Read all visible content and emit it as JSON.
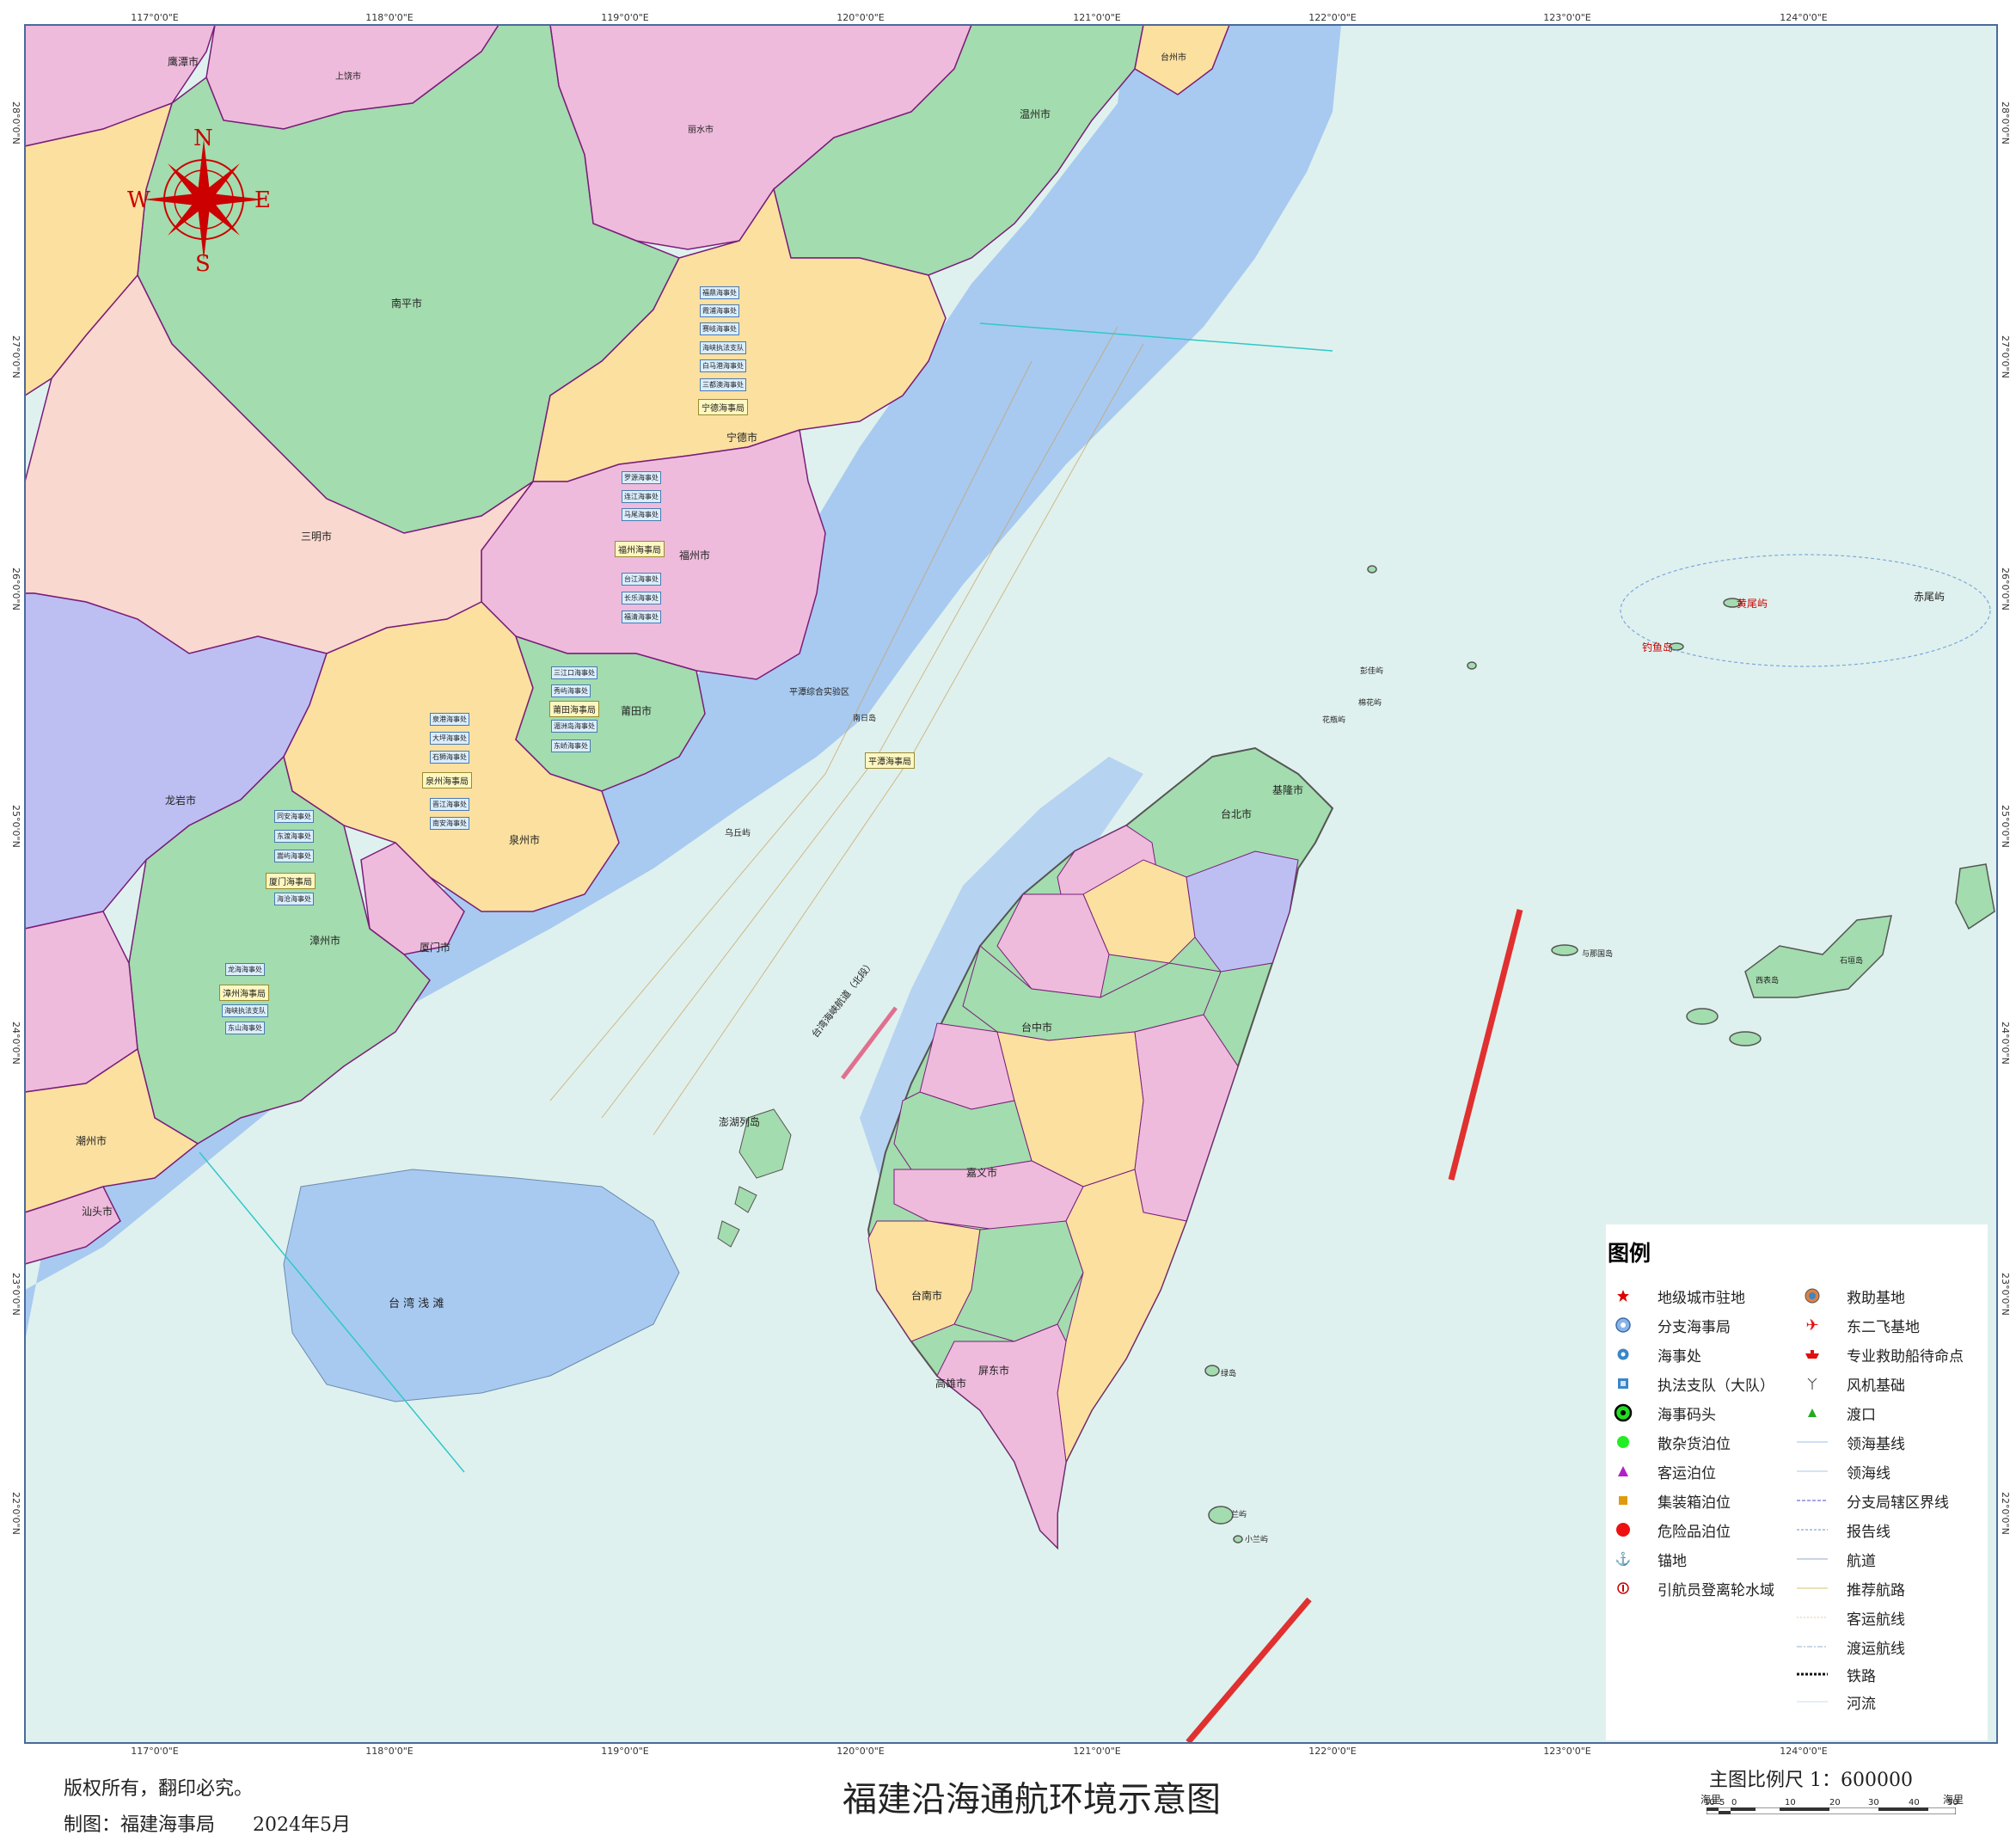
{
  "title": "福建沿海通航环境示意图",
  "copyright": "版权所有，翻印必究。",
  "producer": "制图：福建海事局　　2024年5月",
  "scale": {
    "label": "主图比例尺 1：600000",
    "unit_left": "海里",
    "unit_right": "海里",
    "ticks": [
      "10",
      "5",
      "0",
      "10",
      "20",
      "30",
      "40",
      "50"
    ]
  },
  "compass": {
    "N": "N",
    "S": "S",
    "E": "E",
    "W": "W"
  },
  "graticule": {
    "lon": [
      "117°0'0\"E",
      "118°0'0\"E",
      "119°0'0\"E",
      "120°0'0\"E",
      "121°0'0\"E",
      "122°0'0\"E",
      "123°0'0\"E",
      "124°0'0\"E"
    ],
    "lat": [
      "28°0'0\"N",
      "27°0'0\"N",
      "26°0'0\"N",
      "25°0'0\"N",
      "24°0'0\"N",
      "23°0'0\"N",
      "22°0'0\"N"
    ]
  },
  "cities": {
    "yingtan": "鹰潭市",
    "nanping": "南平市",
    "sanming": "三明市",
    "longyan": "龙岩市",
    "zhangzhou": "漳州市",
    "chaozhou": "潮州市",
    "shantou": "汕头市",
    "quanzhou": "泉州市",
    "xiamen": "厦门市",
    "putian": "莆田市",
    "fuzhou": "福州市",
    "ningde": "宁德市",
    "wenzhou": "温州市",
    "taizhou": "台州市",
    "lishui": "丽水市",
    "shangrao": "上饶市",
    "keelung": "基隆市",
    "taipei": "台北市",
    "taichung": "台中市",
    "chiayi": "嘉义市",
    "tainan": "台南市",
    "kaohsiung": "高雄市",
    "pingtung": "屏东市"
  },
  "msa_bureaus": {
    "ningde": "宁德海事局",
    "fuzhou": "福州海事局",
    "putian": "莆田海事局",
    "quanzhou": "泉州海事局",
    "xiamen": "厦门海事局",
    "zhangzhou": "漳州海事局",
    "pingtan": "平潭海事局"
  },
  "msa_offices": {
    "north": [
      "福鼎海事处",
      "霞浦海事处",
      "赛岐海事处",
      "海峡执法支队",
      "白马港海事处",
      "三都澳海事处"
    ],
    "fuzhou": [
      "罗源海事处",
      "连江海事处",
      "马尾海事处",
      "台江海事处",
      "长乐海事处",
      "福清海事处"
    ],
    "putian": [
      "三江口海事处",
      "秀屿海事处",
      "湄洲岛海事处",
      "东峤海事处"
    ],
    "quanzhou": [
      "泉港海事处",
      "大坪海事处",
      "石狮海事处",
      "晋江海事处",
      "南安海事处"
    ],
    "xiamen": [
      "同安海事处",
      "东渡海事处",
      "嵩屿海事处",
      "海沧海事处"
    ],
    "zhangzhou": [
      "龙海海事处",
      "海峡执法支队",
      "东山海事处"
    ]
  },
  "islands": {
    "wuqiu": "乌丘屿",
    "penghu": "澎湖列岛",
    "taiwan_shoal": "台 湾 浅 滩",
    "huangwei": "黄尾屿",
    "chiwei": "赤尾屿",
    "diaoyu": "钓鱼岛",
    "pengjia": "彭佳屿",
    "mianhua": "棉花屿",
    "huaping": "花瓶屿",
    "lvdao": "绿岛",
    "lanyu": "兰屿",
    "xiaolanyu": "小兰屿",
    "yonaguni": "与那国岛",
    "iriomote": "西表岛",
    "ishigaki": "石垣岛",
    "nanri": "南日岛",
    "haitan": "平潭综合实验区"
  },
  "channel_label": "台湾海峡航道（北段）",
  "legend": {
    "title": "图例",
    "left": [
      {
        "label": "地级城市驻地",
        "icon": "city-star-icon"
      },
      {
        "label": "分支海事局",
        "icon": "branch-msa-icon"
      },
      {
        "label": "海事处",
        "icon": "msa-office-icon"
      },
      {
        "label": "执法支队（大队）",
        "icon": "enforcement-icon"
      },
      {
        "label": "海事码头",
        "icon": "msa-pier-icon"
      },
      {
        "label": "散杂货泊位",
        "icon": "bulk-berth-icon"
      },
      {
        "label": "客运泊位",
        "icon": "passenger-berth-icon"
      },
      {
        "label": "集装箱泊位",
        "icon": "container-berth-icon"
      },
      {
        "label": "危险品泊位",
        "icon": "hazard-berth-icon"
      },
      {
        "label": "锚地",
        "icon": "anchor-icon"
      },
      {
        "label": "引航员登离轮水域",
        "icon": "pilot-icon"
      }
    ],
    "right": [
      {
        "label": "救助基地",
        "icon": "rescue-base-icon"
      },
      {
        "label": "东二飞基地",
        "icon": "flight-base-icon"
      },
      {
        "label": "专业救助船待命点",
        "icon": "rescue-ship-icon"
      },
      {
        "label": "风机基础",
        "icon": "wind-turbine-icon"
      },
      {
        "label": "渡口",
        "icon": "ferry-icon"
      },
      {
        "label": "领海基线",
        "icon": "baseline-icon"
      },
      {
        "label": "领海线",
        "icon": "territorial-line-icon"
      },
      {
        "label": "分支局辖区界线",
        "icon": "boundary-line-icon"
      },
      {
        "label": "报告线",
        "icon": "report-line-icon"
      },
      {
        "label": "航道",
        "icon": "channel-line-icon"
      },
      {
        "label": "推荐航路",
        "icon": "route-line-icon"
      },
      {
        "label": "客运航线",
        "icon": "passenger-route-icon"
      },
      {
        "label": "渡运航线",
        "icon": "ferry-route-icon"
      },
      {
        "label": "铁路",
        "icon": "railway-icon"
      },
      {
        "label": "河流",
        "icon": "river-icon"
      }
    ]
  },
  "colors": {
    "sea": "#dff1ee",
    "nearshore": "#a8caf0",
    "pink": "#eebbdc",
    "green": "#a3dcae",
    "yellow": "#fbe0a0",
    "peach": "#f9d8cf",
    "lavender": "#bdbff2",
    "boundary": "#7a1d7a"
  }
}
